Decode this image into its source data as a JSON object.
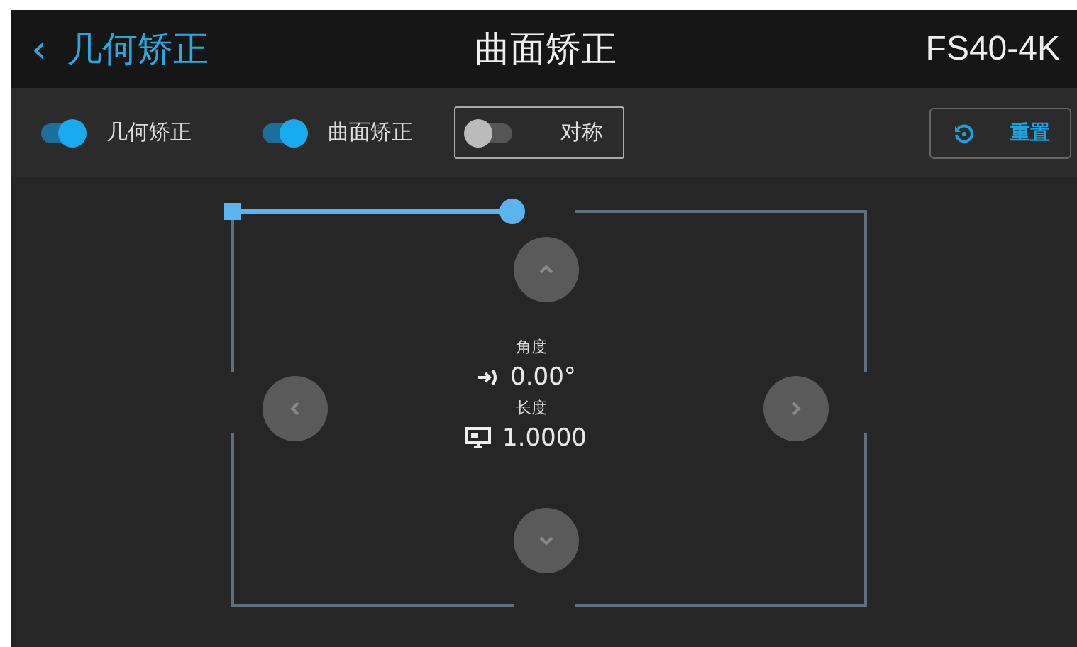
{
  "header": {
    "back_icon": "‹",
    "back_label": "几何矫正",
    "title": "曲面矫正",
    "model": "FS40-4K"
  },
  "toggles": [
    {
      "label": "几何矫正",
      "on": true,
      "selected": false
    },
    {
      "label": "曲面矫正",
      "on": true,
      "selected": false
    },
    {
      "label": "对称",
      "on": false,
      "selected": true
    }
  ],
  "reset_button": {
    "label": "重置"
  },
  "readouts": [
    {
      "kind": "angle",
      "label": "角度",
      "value": "0.00°"
    },
    {
      "kind": "length",
      "label": "长度",
      "value": "1.0000"
    }
  ]
}
